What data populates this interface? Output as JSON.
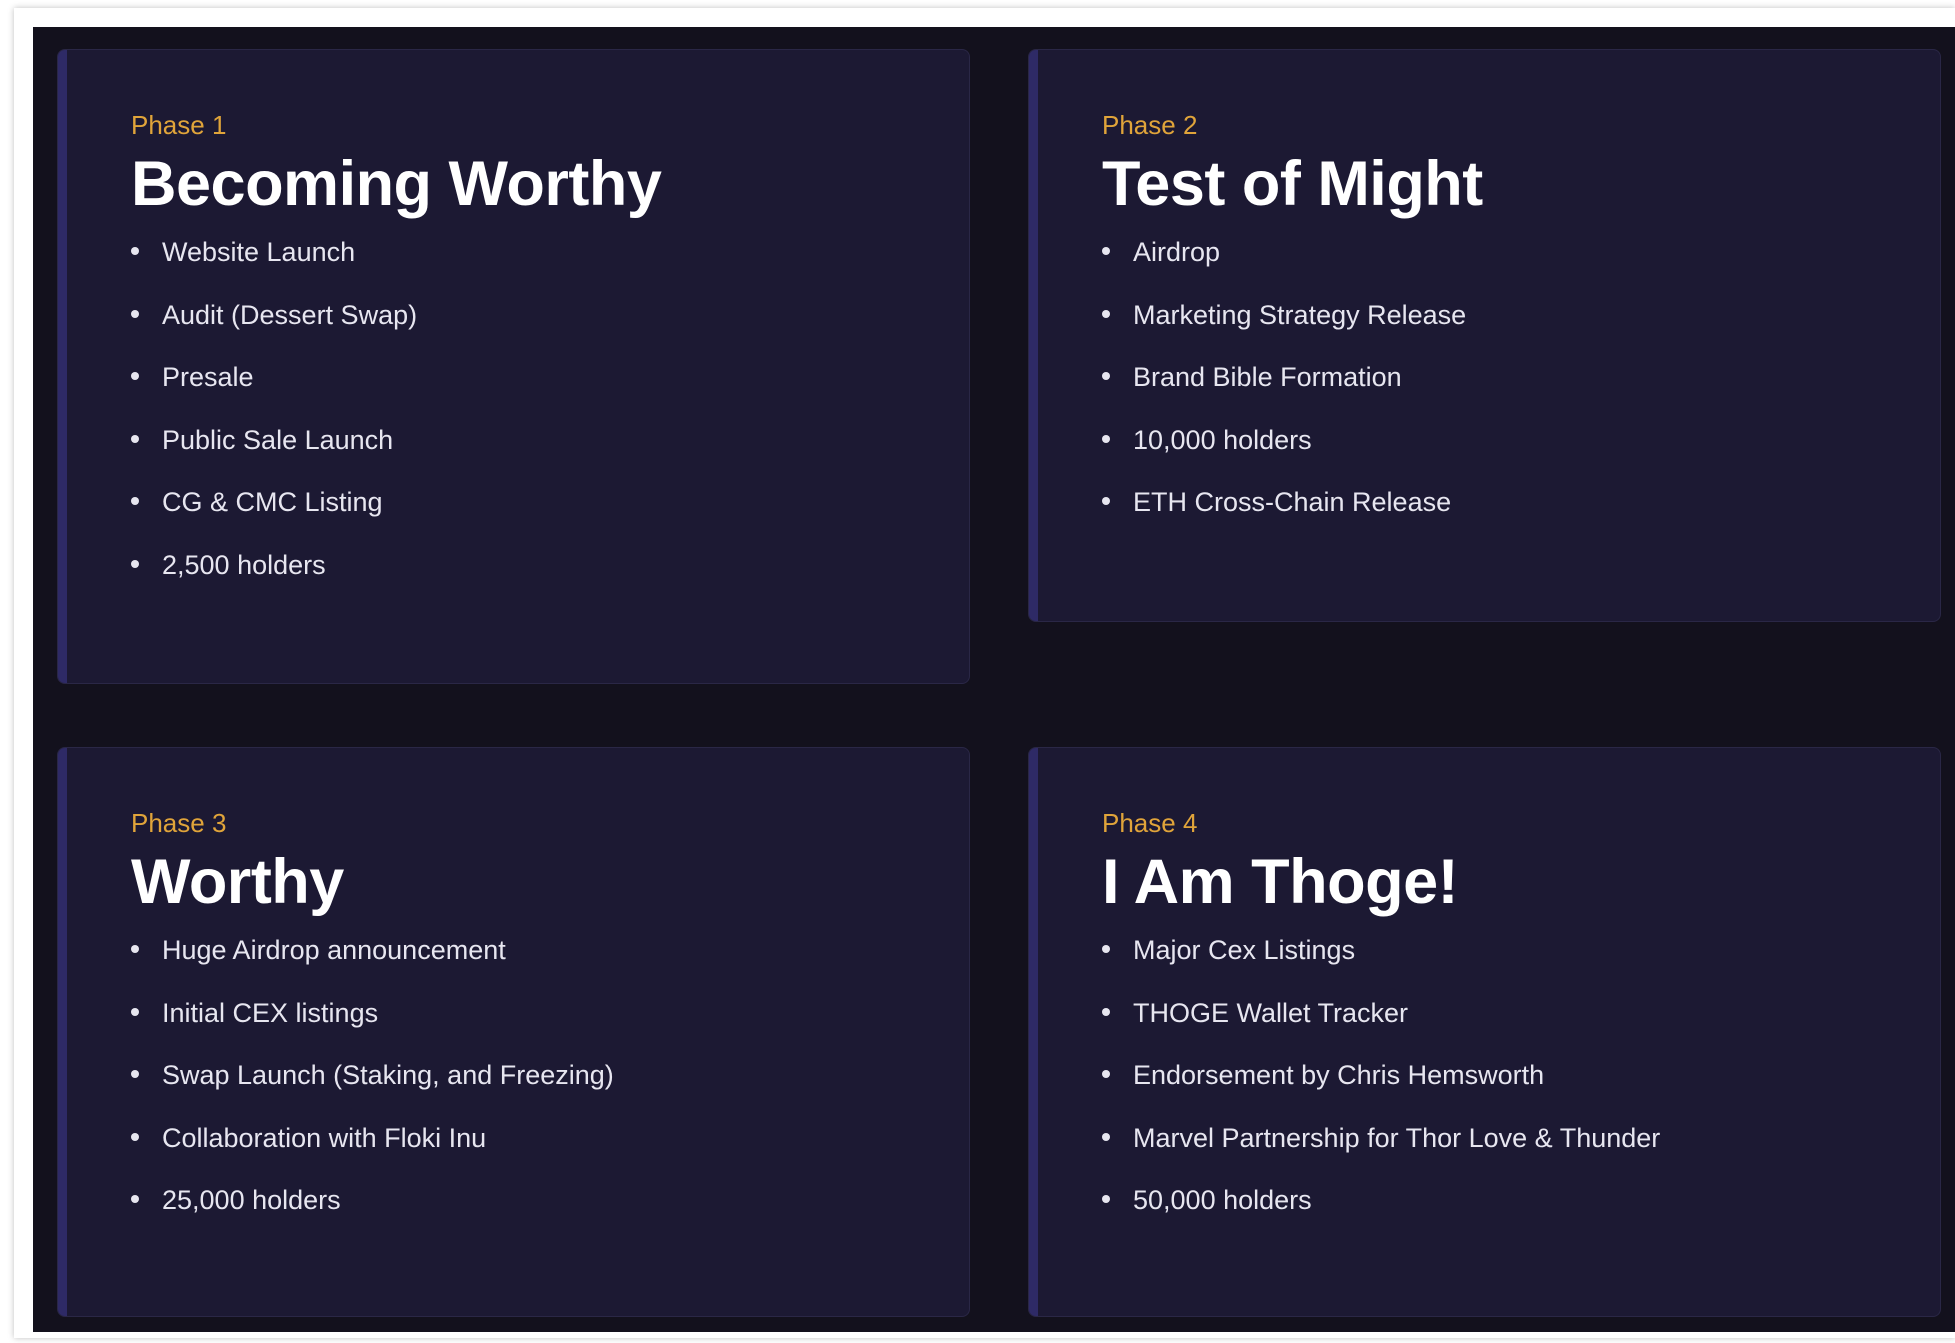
{
  "phases": [
    {
      "phase_label": "Phase 1",
      "title": "Becoming Worthy",
      "items": [
        "Website Launch",
        "Audit (Dessert Swap)",
        "Presale",
        "Public Sale Launch",
        "CG & CMC Listing",
        "2,500 holders"
      ]
    },
    {
      "phase_label": "Phase 2",
      "title": "Test of Might",
      "items": [
        "Airdrop",
        "Marketing Strategy Release",
        "Brand Bible Formation",
        "10,000 holders",
        "ETH Cross-Chain Release"
      ]
    },
    {
      "phase_label": "Phase 3",
      "title": "Worthy",
      "items": [
        "Huge Airdrop announcement",
        "Initial CEX listings",
        "Swap Launch (Staking, and Freezing)",
        "Collaboration with Floki Inu",
        "25,000 holders"
      ]
    },
    {
      "phase_label": "Phase 4",
      "title": "I Am Thoge!",
      "items": [
        "Major Cex Listings",
        "THOGE Wallet Tracker",
        "Endorsement by Chris Hemsworth",
        "Marvel Partnership for Thor Love & Thunder",
        "50,000 holders"
      ]
    }
  ],
  "colors": {
    "background": "#13111d",
    "card": "#1c1933",
    "accent_bar": "#2e2a66",
    "phase_label": "#e0a43a",
    "title": "#ffffff",
    "item_text": "#e7e6f0"
  }
}
